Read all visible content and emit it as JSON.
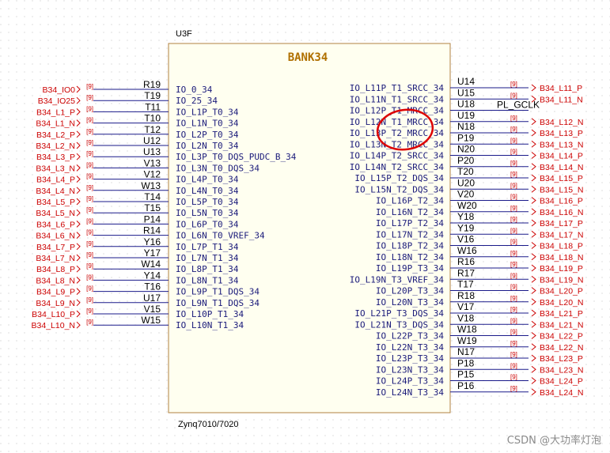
{
  "component": {
    "ref": "U3F",
    "title": "BANK34",
    "part": "Zynq7010/7020"
  },
  "left_pins": [
    {
      "name": "IO_0_34",
      "num": "R19",
      "net": "B34_IO0",
      "tag": "[9]"
    },
    {
      "name": "IO_25_34",
      "num": "T19",
      "net": "B34_IO25",
      "tag": "[9]"
    },
    {
      "name": "IO_L1P_T0_34",
      "num": "T11",
      "net": "B34_L1_P",
      "tag": "[9]"
    },
    {
      "name": "IO_L1N_T0_34",
      "num": "T10",
      "net": "B34_L1_N",
      "tag": "[9]"
    },
    {
      "name": "IO_L2P_T0_34",
      "num": "T12",
      "net": "B34_L2_P",
      "tag": "[9]"
    },
    {
      "name": "IO_L2N_T0_34",
      "num": "U12",
      "net": "B34_L2_N",
      "tag": "[9]"
    },
    {
      "name": "IO_L3P_T0_DQS_PUDC_B_34",
      "num": "U13",
      "net": "B34_L3_P",
      "tag": "[9]"
    },
    {
      "name": "IO_L3N_T0_DQS_34",
      "num": "V13",
      "net": "B34_L3_N",
      "tag": "[9]"
    },
    {
      "name": "IO_L4P_T0_34",
      "num": "V12",
      "net": "B34_L4_P",
      "tag": "[9]"
    },
    {
      "name": "IO_L4N_T0_34",
      "num": "W13",
      "net": "B34_L4_N",
      "tag": "[9]"
    },
    {
      "name": "IO_L5P_T0_34",
      "num": "T14",
      "net": "B34_L5_P",
      "tag": "[9]"
    },
    {
      "name": "IO_L5N_T0_34",
      "num": "T15",
      "net": "B34_L5_N",
      "tag": "[9]"
    },
    {
      "name": "IO_L6P_T0_34",
      "num": "P14",
      "net": "B34_L6_P",
      "tag": "[9]"
    },
    {
      "name": "IO_L6N_T0_VREF_34",
      "num": "R14",
      "net": "B34_L6_N",
      "tag": "[9]"
    },
    {
      "name": "IO_L7P_T1_34",
      "num": "Y16",
      "net": "B34_L7_P",
      "tag": "[9]"
    },
    {
      "name": "IO_L7N_T1_34",
      "num": "Y17",
      "net": "B34_L7_N",
      "tag": "[9]"
    },
    {
      "name": "IO_L8P_T1_34",
      "num": "W14",
      "net": "B34_L8_P",
      "tag": "[9]"
    },
    {
      "name": "IO_L8N_T1_34",
      "num": "Y14",
      "net": "B34_L8_N",
      "tag": "[9]"
    },
    {
      "name": "IO_L9P_T1_DQS_34",
      "num": "T16",
      "net": "B34_L9_P",
      "tag": "[9]"
    },
    {
      "name": "IO_L9N_T1_DQS_34",
      "num": "U17",
      "net": "B34_L9_N",
      "tag": "[9]"
    },
    {
      "name": "IO_L10P_T1_34",
      "num": "V15",
      "net": "B34_L10_P",
      "tag": "[9]"
    },
    {
      "name": "IO_L10N_T1_34",
      "num": "W15",
      "net": "B34_L10_N",
      "tag": "[9]"
    }
  ],
  "right_pins": [
    {
      "name": "IO_L11P_T1_SRCC_34",
      "num": "U14",
      "net": "B34_L11_P",
      "tag": "[9]"
    },
    {
      "name": "IO_L11N_T1_SRCC_34",
      "num": "U15",
      "net": "B34_L11_N",
      "tag": "[9]"
    },
    {
      "name": "IO_L12P_T1_MRCC_34",
      "num": "U18",
      "net": "PL_GCLK",
      "tag": ""
    },
    {
      "name": "IO_L12N_T1_MRCC_34",
      "num": "U19",
      "net": "B34_L12_N",
      "tag": "[9]"
    },
    {
      "name": "IO_L13P_T2_MRCC_34",
      "num": "N18",
      "net": "B34_L13_P",
      "tag": "[9]"
    },
    {
      "name": "IO_L13N_T2_MRCC_34",
      "num": "P19",
      "net": "B34_L13_N",
      "tag": "[9]"
    },
    {
      "name": "IO_L14P_T2_SRCC_34",
      "num": "N20",
      "net": "B34_L14_P",
      "tag": "[9]"
    },
    {
      "name": "IO_L14N_T2_SRCC_34",
      "num": "P20",
      "net": "B34_L14_N",
      "tag": "[9]"
    },
    {
      "name": "IO_L15P_T2_DQS_34",
      "num": "T20",
      "net": "B34_L15_P",
      "tag": "[9]"
    },
    {
      "name": "IO_L15N_T2_DQS_34",
      "num": "U20",
      "net": "B34_L15_N",
      "tag": "[9]"
    },
    {
      "name": "IO_L16P_T2_34",
      "num": "V20",
      "net": "B34_L16_P",
      "tag": "[9]"
    },
    {
      "name": "IO_L16N_T2_34",
      "num": "W20",
      "net": "B34_L16_N",
      "tag": "[9]"
    },
    {
      "name": "IO_L17P_T2_34",
      "num": "Y18",
      "net": "B34_L17_P",
      "tag": "[9]"
    },
    {
      "name": "IO_L17N_T2_34",
      "num": "Y19",
      "net": "B34_L17_N",
      "tag": "[9]"
    },
    {
      "name": "IO_L18P_T2_34",
      "num": "V16",
      "net": "B34_L18_P",
      "tag": "[9]"
    },
    {
      "name": "IO_L18N_T2_34",
      "num": "W16",
      "net": "B34_L18_N",
      "tag": "[9]"
    },
    {
      "name": "IO_L19P_T3_34",
      "num": "R16",
      "net": "B34_L19_P",
      "tag": "[9]"
    },
    {
      "name": "IO_L19N_T3_VREF_34",
      "num": "R17",
      "net": "B34_L19_N",
      "tag": "[9]"
    },
    {
      "name": "IO_L20P_T3_34",
      "num": "T17",
      "net": "B34_L20_P",
      "tag": "[9]"
    },
    {
      "name": "IO_L20N_T3_34",
      "num": "R18",
      "net": "B34_L20_N",
      "tag": "[9]"
    },
    {
      "name": "IO_L21P_T3_DQS_34",
      "num": "V17",
      "net": "B34_L21_P",
      "tag": "[9]"
    },
    {
      "name": "IO_L21N_T3_DQS_34",
      "num": "V18",
      "net": "B34_L21_N",
      "tag": "[9]"
    },
    {
      "name": "IO_L22P_T3_34",
      "num": "W18",
      "net": "B34_L22_P",
      "tag": "[9]"
    },
    {
      "name": "IO_L22N_T3_34",
      "num": "W19",
      "net": "B34_L22_N",
      "tag": "[9]"
    },
    {
      "name": "IO_L23P_T3_34",
      "num": "N17",
      "net": "B34_L23_P",
      "tag": "[9]"
    },
    {
      "name": "IO_L23N_T3_34",
      "num": "P18",
      "net": "B34_L23_N",
      "tag": "[9]"
    },
    {
      "name": "IO_L24P_T3_34",
      "num": "P15",
      "net": "B34_L24_P",
      "tag": "[9]"
    },
    {
      "name": "IO_L24N_T3_34",
      "num": "P16",
      "net": "B34_L24_N",
      "tag": "[9]"
    }
  ],
  "watermark": "CSDN @大功率灯泡",
  "colors": {
    "wire": "#1a1a8a",
    "body_fill": "#fffff0",
    "body_stroke": "#b08040",
    "net": "#cc0000",
    "highlight": "#dd0000"
  }
}
